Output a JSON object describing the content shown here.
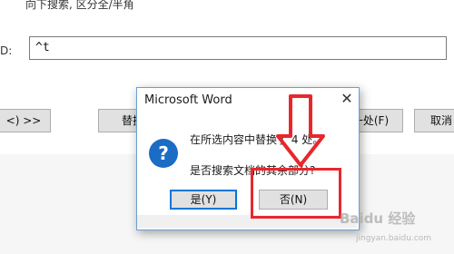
{
  "background": {
    "options_text": "向下搜索, 区分全/半角",
    "find_label": "D:",
    "find_value": "^t",
    "buttons": {
      "more": "<) >>",
      "replace": "替换",
      "find_next": "一处(F)",
      "cancel": "取消"
    }
  },
  "dialog": {
    "title": "Microsoft Word",
    "close_glyph": "✕",
    "icon_glyph": "?",
    "message_line1": "在所选内容中替换了 4 处。",
    "message_line2": "是否搜索文档的其余部分?",
    "yes_label": "是(Y)",
    "no_label": "否(N)"
  },
  "annotation": {
    "highlight_color": "#e8272d"
  },
  "watermark": {
    "text": "Baidu 经验",
    "sub": "jingyan.baidu.com"
  }
}
